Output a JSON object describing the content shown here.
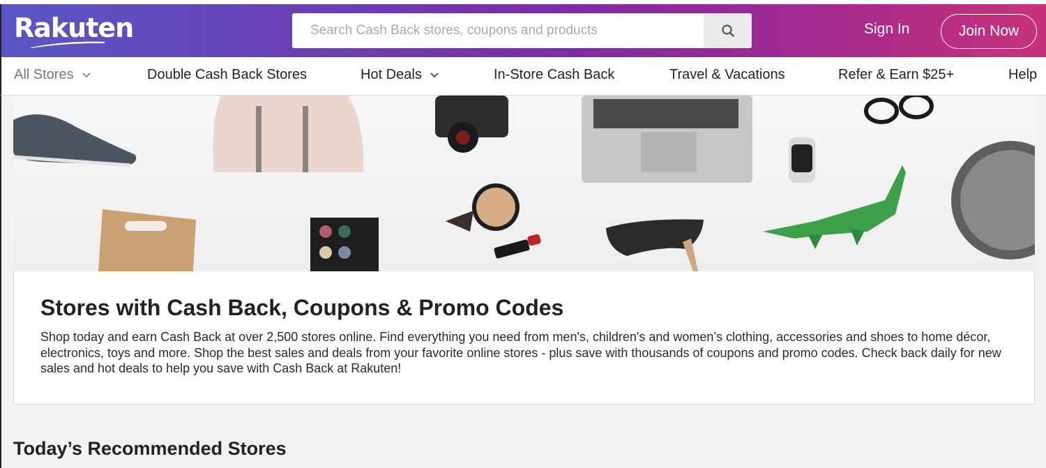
{
  "header": {
    "logo_text": "Rakuten",
    "search_placeholder": "Search Cash Back stores, coupons and products",
    "search_icon": "search-icon",
    "signin_label": "Sign In",
    "join_label": "Join Now",
    "gradient_colors": [
      "#5a56c4",
      "#7e2ba3",
      "#c7327a"
    ]
  },
  "nav": {
    "items": [
      {
        "label": "All Stores",
        "icon": "chevron-down-icon"
      },
      {
        "label": "Double Cash Back Stores"
      },
      {
        "label": "Hot Deals",
        "icon": "chevron-down-icon"
      },
      {
        "label": "In-Store Cash Back"
      },
      {
        "label": "Travel & Vacations"
      },
      {
        "label": "Refer & Earn $25+"
      },
      {
        "label": "Help"
      }
    ]
  },
  "intro": {
    "title": "Stores with Cash Back, Coupons & Promo Codes",
    "description": "Shop today and earn Cash Back at over 2,500 stores online. Find everything you need from men's, children's and women’s clothing, accessories and shoes to home décor, electronics, toys and more. Shop the best sales and deals from your favorite online stores - plus save with thousands of coupons and promo codes. Check back daily for new sales and hot deals to help you save with Cash Back at Rakuten!"
  },
  "recommended": {
    "title": "Today’s Recommended Stores"
  }
}
